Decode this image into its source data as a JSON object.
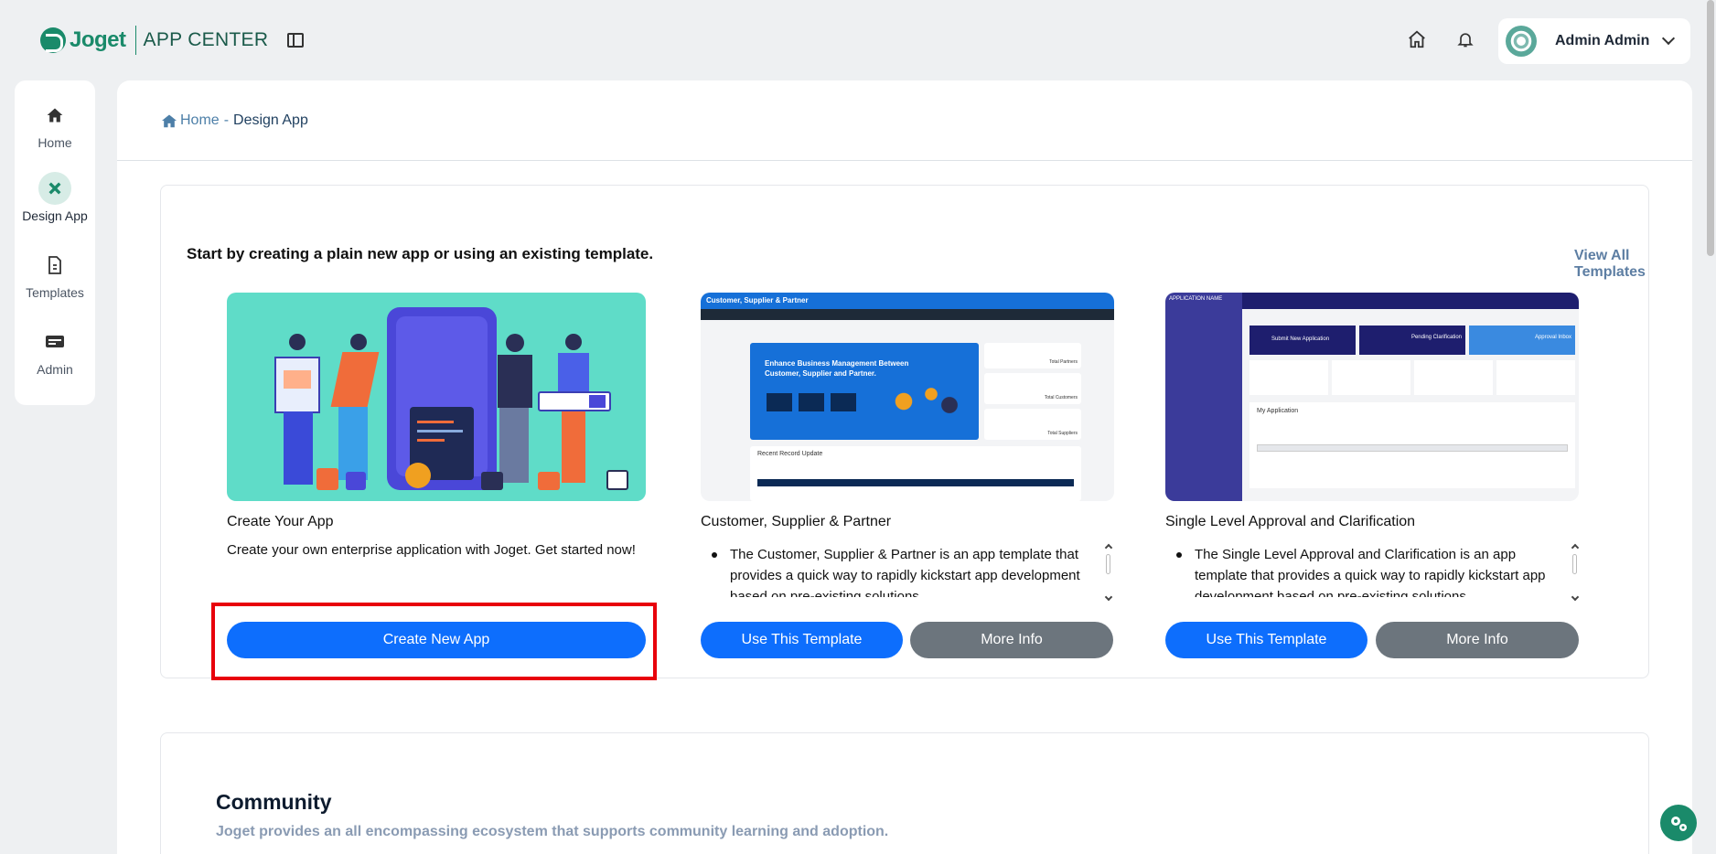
{
  "topbar": {
    "logo_text": "Joget",
    "app_title": "APP CENTER",
    "user_name": "Admin Admin"
  },
  "nav": {
    "items": [
      {
        "label": "Home"
      },
      {
        "label": "Design App"
      },
      {
        "label": "Templates"
      },
      {
        "label": "Admin"
      }
    ]
  },
  "breadcrumb": {
    "home": "Home",
    "separator": "-",
    "current": "Design App"
  },
  "intro": {
    "text": "Start by creating a plain new app or using an existing template.",
    "view_all": "View All Templates"
  },
  "cards": [
    {
      "title": "Create Your App",
      "description": "Create your own enterprise application with Joget. Get started now!",
      "primary_label": "Create New App"
    },
    {
      "title": "Customer, Supplier & Partner",
      "description": "The Customer, Supplier & Partner is an app template that provides a quick way to rapidly kickstart app development based on pre-existing solutions.",
      "primary_label": "Use This Template",
      "secondary_label": "More Info",
      "preview": {
        "header": "Customer, Supplier & Partner",
        "banner": "Enhance Business Management Between Customer, Supplier and Partner.",
        "stats": [
          "Total Partners",
          "Total Customers",
          "Total Suppliers"
        ],
        "table_title": "Recent Record Update"
      }
    },
    {
      "title": "Single Level Approval and Clarification",
      "description": "The Single Level Approval and Clarification is an app template that provides a quick way to rapidly kickstart app development based on pre-existing solutions.",
      "primary_label": "Use This Template",
      "secondary_label": "More Info",
      "preview": {
        "header": "APPLICATION NAME",
        "tiles": [
          "Submit New Application",
          "Pending Clarification",
          "Approval Inbox"
        ],
        "table_title": "My Application"
      }
    }
  ],
  "community": {
    "title": "Community",
    "subtitle": "Joget provides an all encompassing ecosystem that supports community learning and adoption."
  },
  "colors": {
    "brand": "#1a8a6a",
    "primary_button": "#0d6efd",
    "secondary_button": "#6c757d",
    "highlight": "#e8000b"
  }
}
